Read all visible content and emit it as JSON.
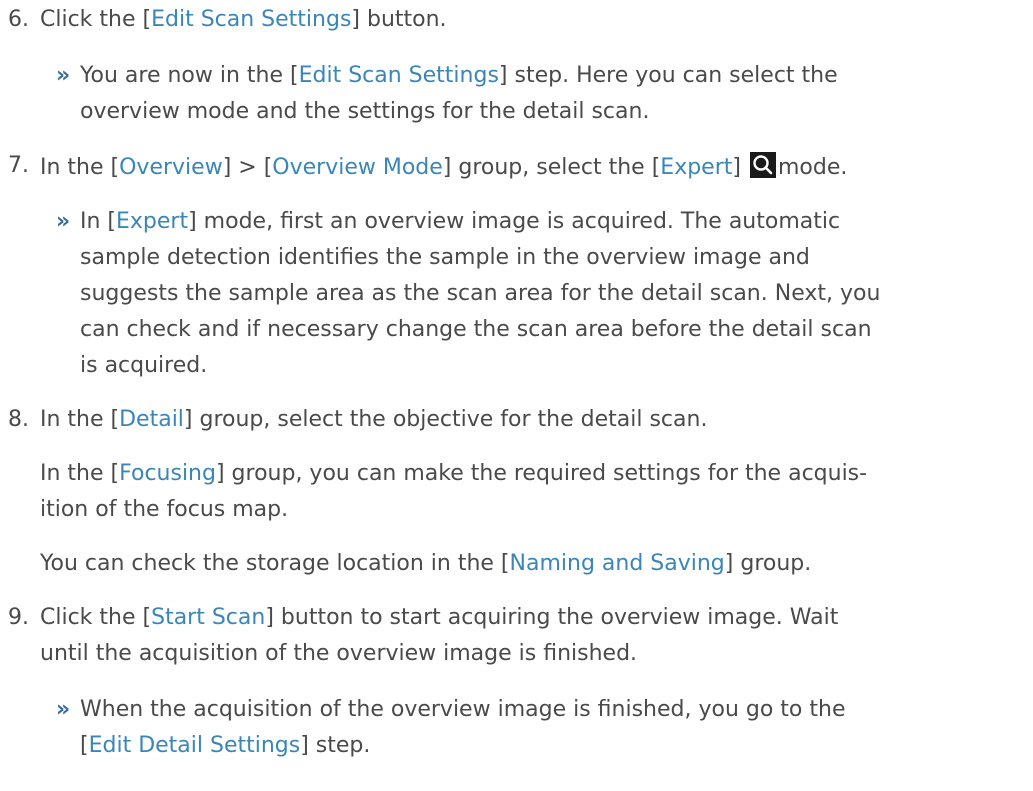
{
  "steps": {
    "s6": {
      "number": "6.",
      "text_a": "Click the [",
      "ui_a": "Edit Scan Settings",
      "text_b": "] button.",
      "result": {
        "bullet": "»",
        "l1_a": "You are now in the [",
        "l1_ui": "Edit Scan Settings",
        "l1_b": "] step. Here you can select the",
        "l2": "overview mode and the settings for the detail scan."
      }
    },
    "s7": {
      "number": "7.",
      "text_a": "In the [",
      "ui_a": "Overview",
      "text_b": "] > [",
      "ui_b": "Overview Mode",
      "text_c": "] group, select the [",
      "ui_c": "Expert",
      "text_d": "]",
      "icon": "magnifier-icon",
      "text_e": "mode.",
      "result": {
        "bullet": "»",
        "l1_a": "In [",
        "l1_ui": "Expert",
        "l1_b": "] mode, first an overview image is acquired. The automatic",
        "l2": "sample detection identifies the sample in the overview image and",
        "l3": "suggests the sample area as the scan area for the detail scan. Next, you",
        "l4": "can check and if necessary change the scan area before the detail scan",
        "l5": "is acquired."
      }
    },
    "s8": {
      "number": "8.",
      "text_a": "In the [",
      "ui_a": "Detail",
      "text_b": "] group, select the objective for the detail scan.",
      "p2_a": "In the [",
      "p2_ui": "Focusing",
      "p2_b": "] group, you can make the required settings for the acquis-",
      "p2_l2": "ition of the focus map.",
      "p3_a": "You can check the storage location in the [",
      "p3_ui": "Naming and Saving",
      "p3_b": "] group."
    },
    "s9": {
      "number": "9.",
      "text_a": "Click the [",
      "ui_a": "Start Scan",
      "text_b": "] button to start acquiring the overview image. Wait",
      "l2": "until the acquisition of the overview image is finished.",
      "result": {
        "bullet": "»",
        "l1": "When the acquisition of the overview image is finished, you go to the",
        "l2_a": "[",
        "l2_ui": "Edit Detail Settings",
        "l2_b": "] step."
      }
    }
  }
}
